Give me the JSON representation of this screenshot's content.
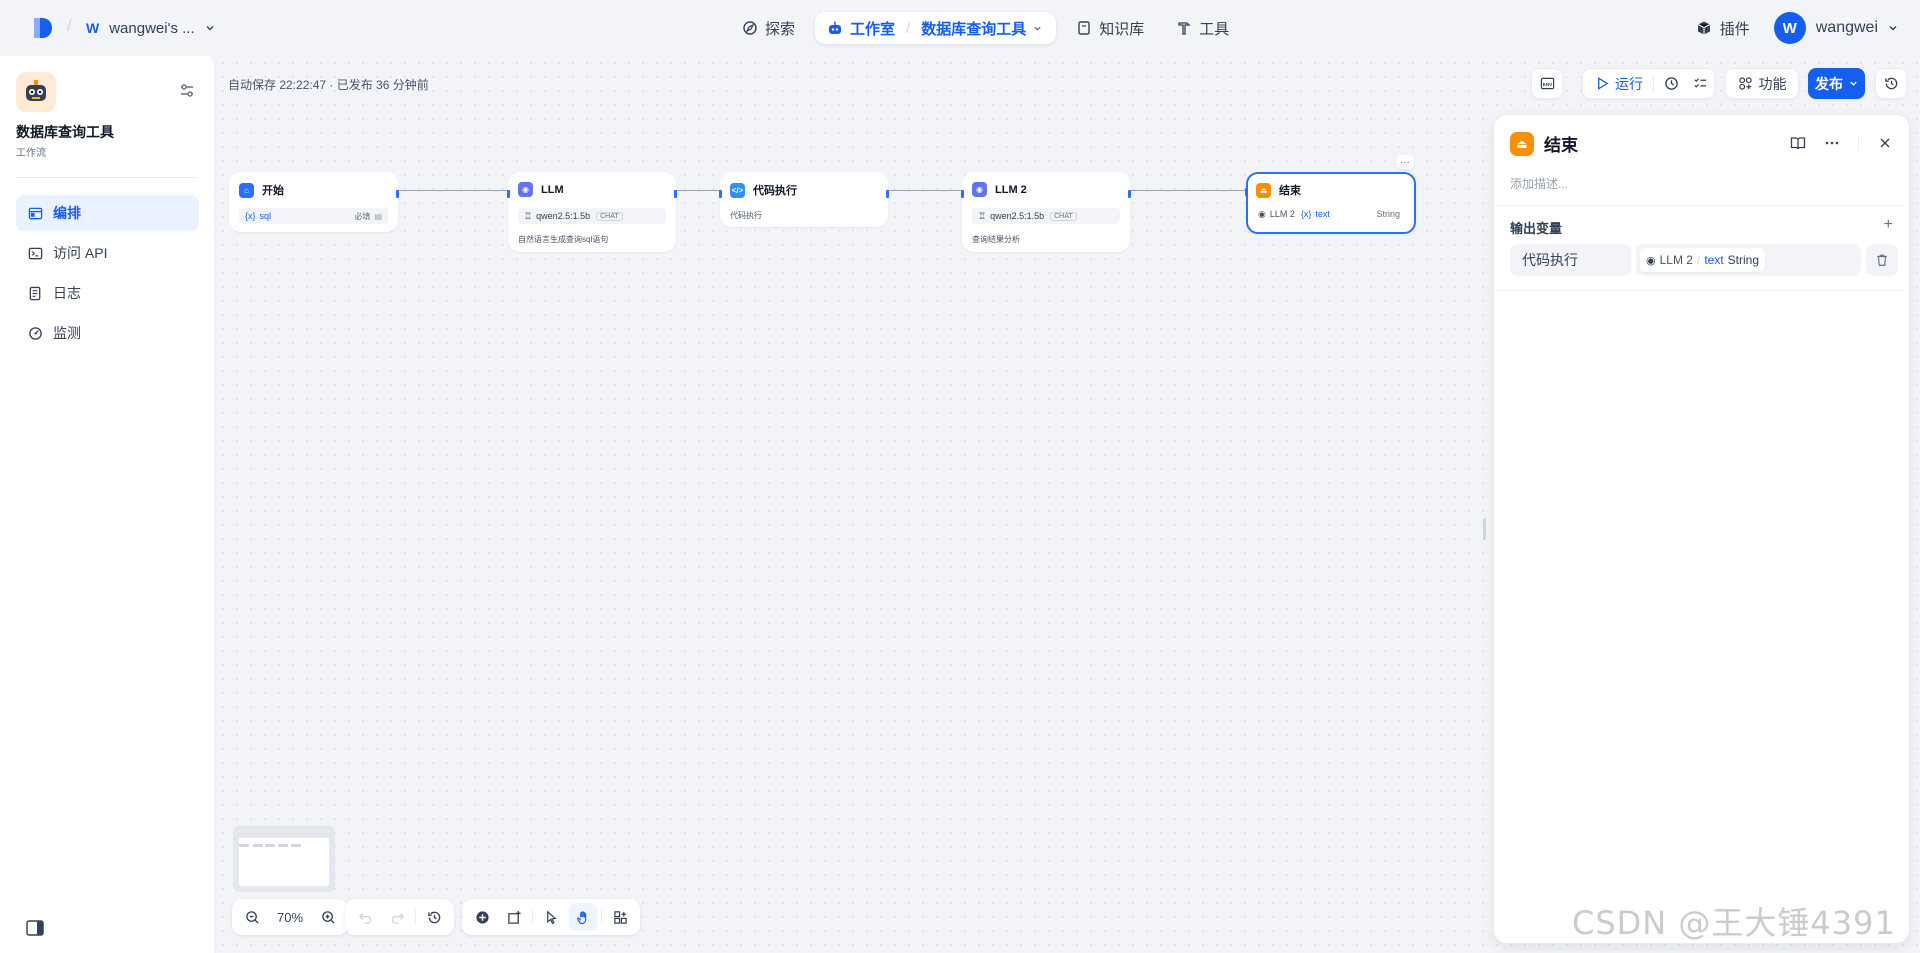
{
  "header": {
    "workspace_avatar": "W",
    "workspace_name": "wangwei's ...",
    "nav": {
      "explore": "探索",
      "studio": "工作室",
      "app_name": "数据库查询工具",
      "knowledge": "知识库",
      "tools": "工具"
    },
    "plugins": "插件",
    "user_avatar": "W",
    "user_name": "wangwei"
  },
  "sidebar": {
    "app_name": "数据库查询工具",
    "app_type": "工作流",
    "items": [
      {
        "label": "编排",
        "icon": "layout-icon",
        "active": true
      },
      {
        "label": "访问 API",
        "icon": "terminal-icon",
        "active": false
      },
      {
        "label": "日志",
        "icon": "file-list-icon",
        "active": false
      },
      {
        "label": "监测",
        "icon": "gauge-icon",
        "active": false
      }
    ]
  },
  "toolbar": {
    "autosave": "自动保存 22:22:47 · 已发布 36 分钟前",
    "env": "ENV",
    "run": "运行",
    "features": "功能",
    "publish": "发布"
  },
  "nodes": {
    "start": {
      "title": "开始",
      "var_icon": "{x}",
      "var": "sql",
      "required": "必填"
    },
    "llm1": {
      "title": "LLM",
      "model": "qwen2.5:1.5b",
      "tag": "CHAT",
      "desc": "自然语言生成查询sql语句"
    },
    "code": {
      "title": "代码执行",
      "desc": "代码执行"
    },
    "llm2": {
      "title": "LLM 2",
      "model": "qwen2.5:1.5b",
      "tag": "CHAT",
      "desc": "查询结果分析"
    },
    "end": {
      "title": "结束",
      "source": "LLM 2",
      "var_icon": "{x}",
      "var": "text",
      "type": "String"
    }
  },
  "panel": {
    "title": "结束",
    "desc_placeholder": "添加描述...",
    "output_label": "输出变量",
    "var_name": "代码执行",
    "ref_source": "LLM 2",
    "ref_var": "text",
    "ref_type": "String"
  },
  "controls": {
    "zoom": "70%"
  },
  "watermark": "CSDN @王大锤4391",
  "colors": {
    "primary": "#155eef",
    "end_node": "#f79009",
    "llm_node": "#6172f3",
    "code_node": "#2e90fa",
    "start_node": "#2970ff"
  }
}
